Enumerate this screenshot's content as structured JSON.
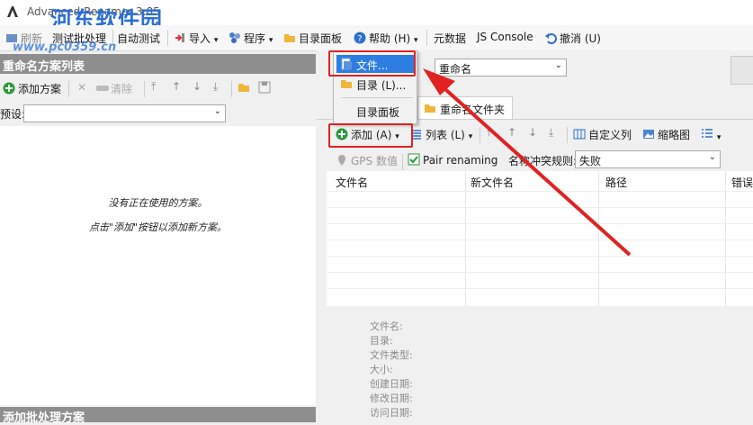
{
  "window": {
    "title": "Advanced Renamer 3.85"
  },
  "watermark": {
    "text": "河东软件园",
    "url": "www.pc0359.cn"
  },
  "toolbar": {
    "items": [
      {
        "label": "刷新"
      },
      {
        "label": "测试批处理"
      },
      {
        "label": "自动测试"
      },
      {
        "label": "导入"
      },
      {
        "label": "程序"
      },
      {
        "label": "目录面板"
      },
      {
        "label": "帮助 (H)"
      },
      {
        "label": "元数据"
      },
      {
        "label": "JS Console"
      },
      {
        "label": "撤消 (U)"
      }
    ]
  },
  "left_panel": {
    "header": "重命名方案列表",
    "add_label": "添加方案",
    "clear_label": "清除",
    "preset_label": "预设:",
    "preset_value": "",
    "empty_line1": "没有正在使用的方案。",
    "empty_line2": "点击\"添加\"按钮以添加新方案。",
    "footer": "添加批处理方案"
  },
  "right_panel": {
    "mode_value": "重命名",
    "tabs": [
      {
        "label": "重命名文件夹"
      }
    ],
    "add_label": "添加 (A)",
    "list_label": "列表 (L)",
    "custom_cols_label": "自定义列",
    "thumbnail_label": "缩略图",
    "gps_label": "GPS 数值",
    "pair_label": "Pair renaming",
    "conflict_label": "名称冲突规则:",
    "conflict_value": "失败",
    "columns": [
      {
        "label": "文件名"
      },
      {
        "label": "新文件名"
      },
      {
        "label": "路径"
      },
      {
        "label": "错误"
      }
    ],
    "info_fields": [
      {
        "label": "文件名:"
      },
      {
        "label": "目录:"
      },
      {
        "label": "文件类型:"
      },
      {
        "label": "大小:"
      },
      {
        "label": "创建日期:"
      },
      {
        "label": "修改日期:"
      },
      {
        "label": "访问日期:"
      }
    ]
  },
  "add_menu": {
    "items": [
      {
        "label": "文件..."
      },
      {
        "label": "目录 (L)..."
      },
      {
        "label": "目录面板"
      }
    ]
  },
  "colors": {
    "accent": "#2e7de1",
    "highlight": "#e02222",
    "header_gray": "#8e8e8e"
  }
}
